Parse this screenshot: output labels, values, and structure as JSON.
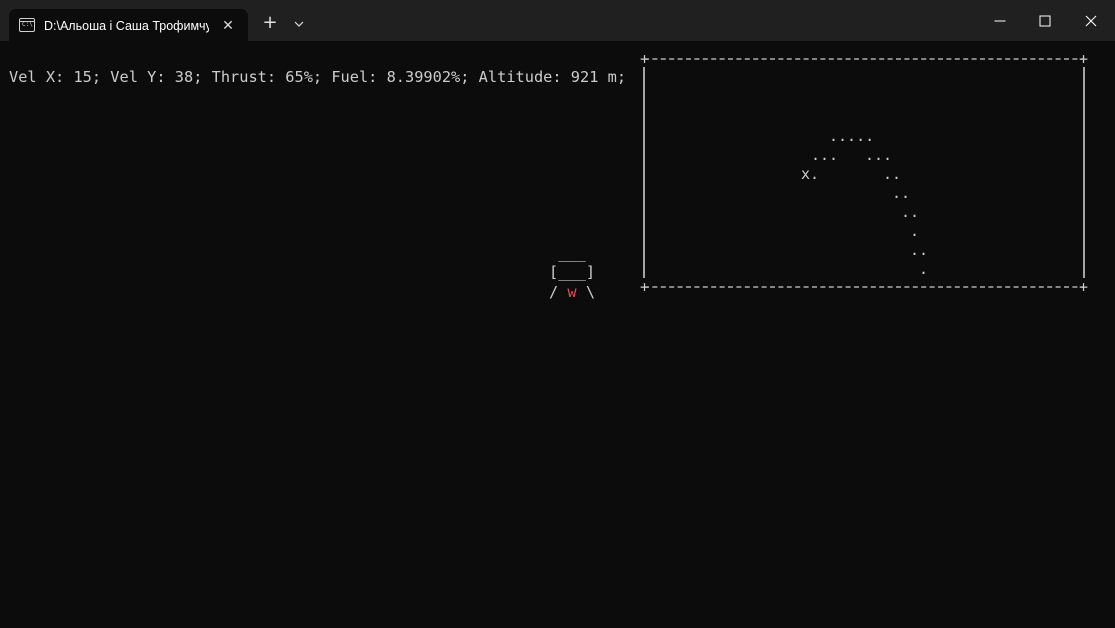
{
  "window": {
    "tab_title": "D:\\Альоша і Саша Трофимчук",
    "tab_icon": "terminal-icon",
    "tab_close_glyph": "✕",
    "new_tab_glyph": "+",
    "icon_label": "C:\\"
  },
  "terminal": {
    "status_line": "Vel X: 15; Vel Y: 38; Thrust: 65%; Fuel: 8.39902%; Altitude: 921 m;",
    "lander": {
      "top": " ___",
      "body": "[___]",
      "leg_left": "/ ",
      "thruster": "w",
      "leg_right": " \\"
    },
    "trajectory_plot": {
      "corner_glyph": "+",
      "start_marker": "x.",
      "trail_dots": [
        ".....",
        "...",
        "...",
        "..",
        "..",
        "..",
        ".",
        "..",
        "."
      ]
    }
  },
  "colors": {
    "background": "#0c0c0c",
    "titlebar": "#202020",
    "text": "#cccccc",
    "thruster": "#e74856"
  }
}
